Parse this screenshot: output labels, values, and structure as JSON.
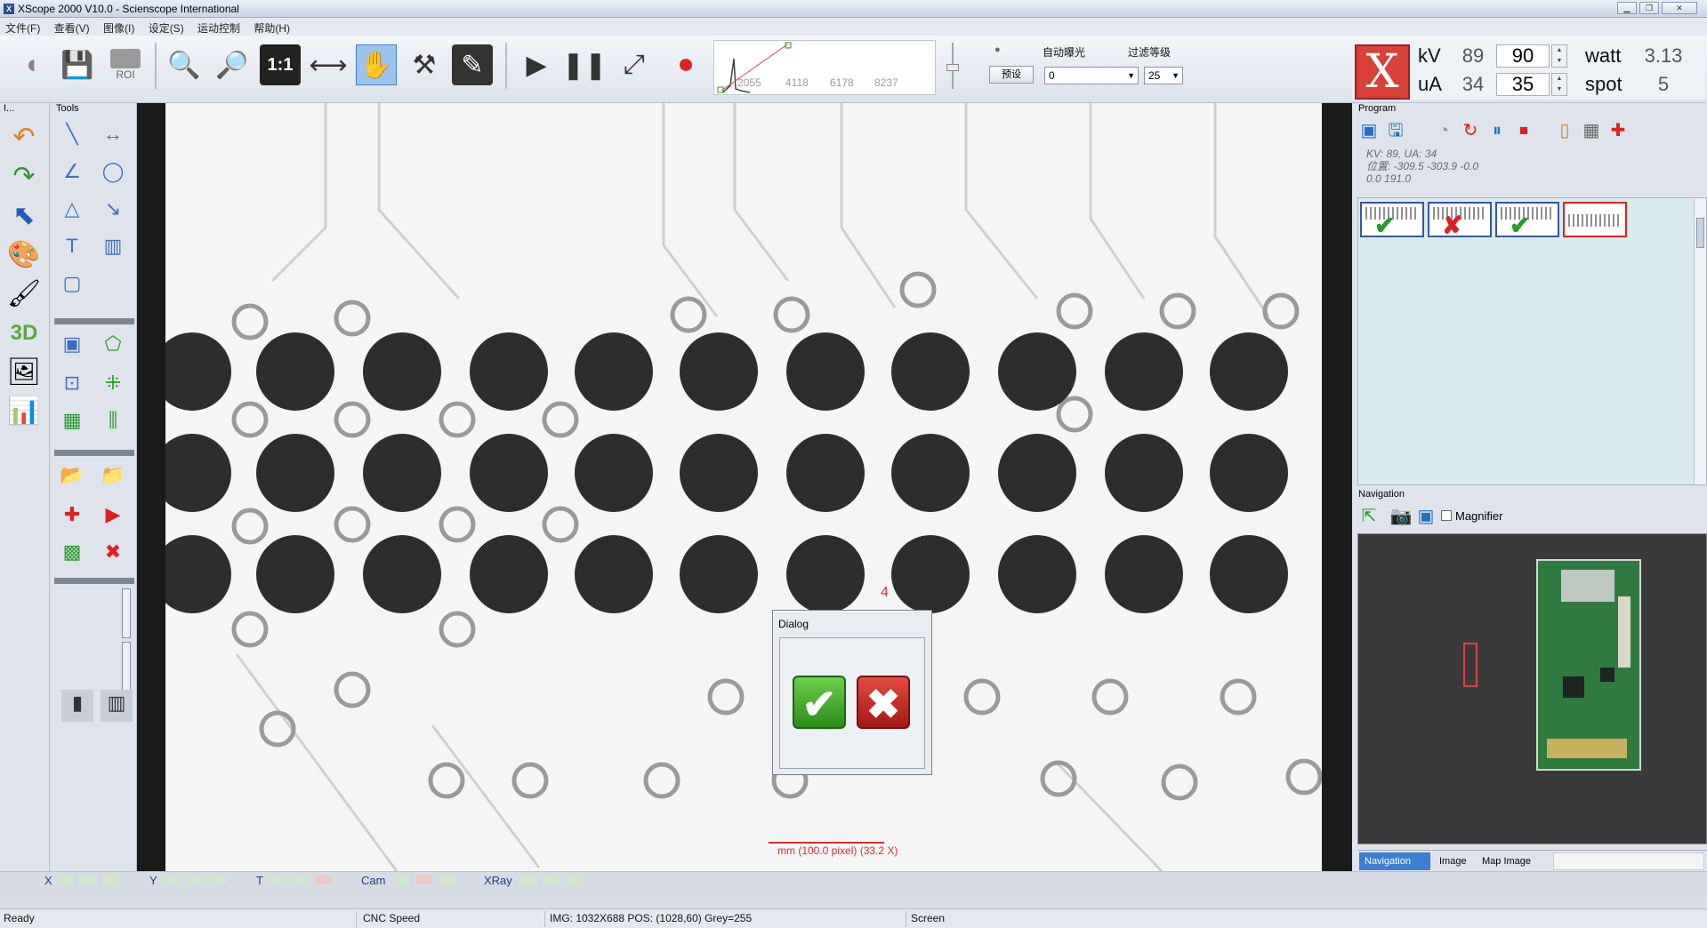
{
  "window": {
    "title": "XScope 2000 V10.0 - Scienscope International"
  },
  "menu": [
    "文件(F)",
    "查看(V)",
    "图像(I)",
    "设定(S)",
    "运动控制",
    "帮助(H)"
  ],
  "toolbar": {
    "roi_label": "ROI",
    "ratio_label": "1:1",
    "histogram_ticks": [
      "2055",
      "4118",
      "6178",
      "8237"
    ],
    "preset_button": "预设",
    "auto_exposure_label": "自动曝光",
    "auto_exposure_value": "0",
    "filter_label": "过滤等级",
    "filter_value": "25"
  },
  "xray": {
    "kv_label": "kV",
    "kv_actual": "89",
    "kv_set": "90",
    "ua_label": "uA",
    "ua_actual": "34",
    "ua_set": "35",
    "watt_label": "watt",
    "watt_value": "3.13",
    "spot_label": "spot",
    "spot_value": "5"
  },
  "left_panel": {
    "header": "I..."
  },
  "tools_panel": {
    "header": "Tools"
  },
  "image": {
    "marker": "4",
    "scale_label": "mm (100.0 pixel) (33.2 X)"
  },
  "dialog": {
    "title": "Dialog",
    "ok_label": "✔",
    "cancel_label": "✖"
  },
  "program": {
    "header": "Program",
    "info_lines": [
      "KV:  89, UA:  34",
      "位置:  -309.5 -303.9 -0.0",
      "0.0 191.0"
    ],
    "thumbnails": [
      {
        "index": "1",
        "status": "pass"
      },
      {
        "index": "2",
        "status": "fail"
      },
      {
        "index": "3",
        "status": "pass"
      },
      {
        "index": "4",
        "status": "selected"
      }
    ]
  },
  "navigation": {
    "header": "Navigation",
    "magnifier_label": "Magnifier",
    "tabs": [
      "Navigation",
      "Image",
      "Map Image"
    ]
  },
  "axes": {
    "labels": [
      "X",
      "Y",
      "T",
      "Cam",
      "XRay"
    ]
  },
  "status": {
    "ready": "Ready",
    "cnc": "CNC Speed",
    "img_info": "IMG: 1032X688  POS: (1028,60) Grey=255",
    "screen": "Screen"
  },
  "colors": {
    "accent": "#3b7fd0",
    "xray_button": "#d84038",
    "ok": "#2c8c1a",
    "cancel": "#a51812"
  }
}
